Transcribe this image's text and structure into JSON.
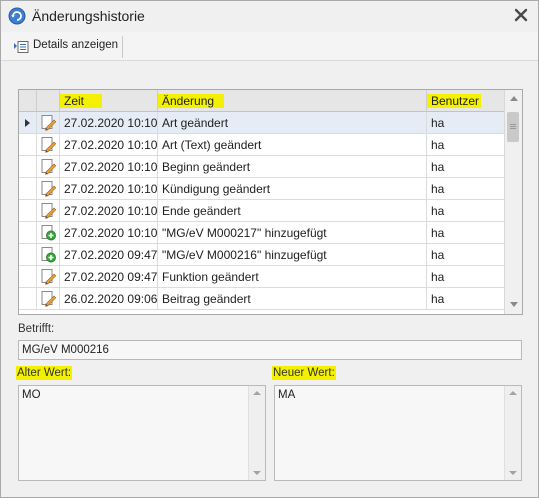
{
  "window": {
    "title": "Änderungshistorie",
    "icon": "history-refresh-icon",
    "close_icon": "close-icon"
  },
  "toolbar": {
    "details_label": "Details anzeigen",
    "details_icon": "details-list-icon"
  },
  "grid": {
    "columns": {
      "time": "Zeit",
      "change": "Änderung",
      "user": "Benutzer"
    },
    "highlight_color": "#f3f000",
    "selected_row": 0,
    "rows": [
      {
        "icon": "edit-pencil-icon",
        "time": "27.02.2020 10:10",
        "change": "Art geändert",
        "user": "ha"
      },
      {
        "icon": "edit-pencil-icon",
        "time": "27.02.2020 10:10",
        "change": "Art (Text) geändert",
        "user": "ha"
      },
      {
        "icon": "edit-pencil-icon",
        "time": "27.02.2020 10:10",
        "change": "Beginn geändert",
        "user": "ha"
      },
      {
        "icon": "edit-pencil-icon",
        "time": "27.02.2020 10:10",
        "change": "Kündigung geändert",
        "user": "ha"
      },
      {
        "icon": "edit-pencil-icon",
        "time": "27.02.2020 10:10",
        "change": "Ende geändert",
        "user": "ha"
      },
      {
        "icon": "add-document-icon",
        "time": "27.02.2020 10:10",
        "change": "\"MG/eV M000217\" hinzugefügt",
        "user": "ha"
      },
      {
        "icon": "add-document-icon",
        "time": "27.02.2020 09:47",
        "change": "\"MG/eV M000216\" hinzugefügt",
        "user": "ha"
      },
      {
        "icon": "edit-pencil-icon",
        "time": "27.02.2020 09:47",
        "change": "Funktion geändert",
        "user": "ha"
      },
      {
        "icon": "edit-pencil-icon",
        "time": "26.02.2020 09:06",
        "change": "Beitrag geändert",
        "user": "ha"
      }
    ]
  },
  "details": {
    "subject_label": "Betrifft:",
    "subject_value": "MG/eV M000216",
    "old_label": "Alter Wert:",
    "old_value": "MO",
    "new_label": "Neuer Wert:",
    "new_value": "MA"
  }
}
